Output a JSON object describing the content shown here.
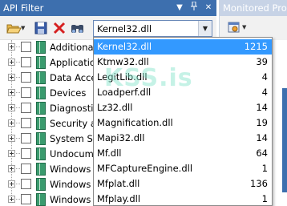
{
  "panel": {
    "title": "API Filter",
    "title_buttons": [
      "dropdown-arrow-icon",
      "pin-icon",
      "close-icon"
    ]
  },
  "toolbar": {
    "icons": [
      "folder-open-icon",
      "save-icon",
      "delete-icon",
      "binoculars-find-icon"
    ]
  },
  "combo": {
    "value": "Kernel32.dll"
  },
  "tree": {
    "items": [
      {
        "label": "Additional"
      },
      {
        "label": "Application"
      },
      {
        "label": "Data Access"
      },
      {
        "label": "Devices"
      },
      {
        "label": "Diagnostic"
      },
      {
        "label": "Security and"
      },
      {
        "label": "System Services"
      },
      {
        "label": "Undocumented"
      },
      {
        "label": "Windows"
      },
      {
        "label": "Windows"
      },
      {
        "label": "Windows"
      }
    ]
  },
  "panel2": {
    "title": "Monitored Processes"
  },
  "dropdown": {
    "items": [
      {
        "name": "Kernel32.dll",
        "count": "1215",
        "selected": true
      },
      {
        "name": "Ktmw32.dll",
        "count": "39"
      },
      {
        "name": "LegitLib.dll",
        "count": "4"
      },
      {
        "name": "Loadperf.dll",
        "count": "4"
      },
      {
        "name": "Lz32.dll",
        "count": "14"
      },
      {
        "name": "Magnification.dll",
        "count": "19"
      },
      {
        "name": "Mapi32.dll",
        "count": "14"
      },
      {
        "name": "Mf.dll",
        "count": "64"
      },
      {
        "name": "MFCaptureEngine.dll",
        "count": "1"
      },
      {
        "name": "Mfplat.dll",
        "count": "136"
      },
      {
        "name": "Mfplay.dll",
        "count": "1"
      }
    ]
  },
  "watermark": "KSS.is",
  "colors": {
    "title_bar": "#3d6fae",
    "selection": "#3399ff",
    "book_icon": "#3a9b6e"
  }
}
